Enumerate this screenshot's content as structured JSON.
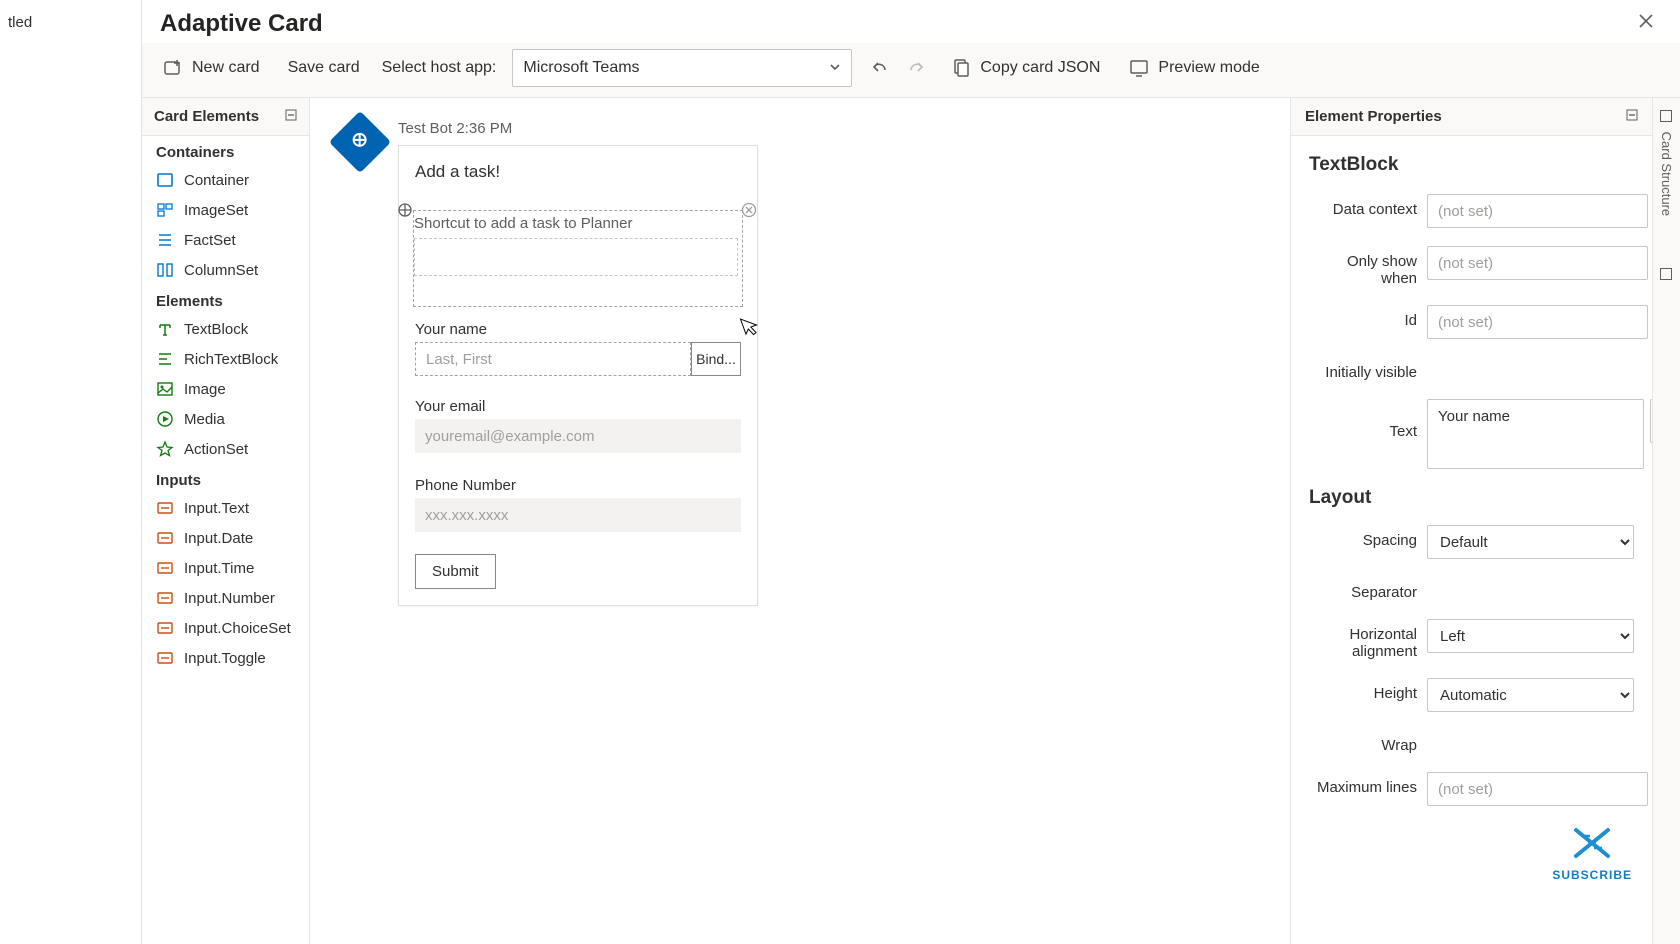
{
  "leftStub": {
    "tabText": "tled"
  },
  "title": "Adaptive Card",
  "toolbar": {
    "newCard": "New card",
    "saveCard": "Save card",
    "hostLabel": "Select host app:",
    "hostValue": "Microsoft Teams",
    "copyJson": "Copy card JSON",
    "preview": "Preview mode"
  },
  "elementsPanel": {
    "title": "Card Elements",
    "groups": [
      {
        "name": "Containers",
        "items": [
          "Container",
          "ImageSet",
          "FactSet",
          "ColumnSet"
        ]
      },
      {
        "name": "Elements",
        "items": [
          "TextBlock",
          "RichTextBlock",
          "Image",
          "Media",
          "ActionSet"
        ]
      },
      {
        "name": "Inputs",
        "items": [
          "Input.Text",
          "Input.Date",
          "Input.Time",
          "Input.Number",
          "Input.ChoiceSet",
          "Input.Toggle"
        ]
      }
    ]
  },
  "card": {
    "sender": "Test Bot 2:36 PM",
    "title": "Add a task!",
    "selectedText": "Shortcut to add a task to Planner",
    "nameLabel": "Your name",
    "namePlaceholder": "Last, First",
    "bind": "Bind...",
    "emailLabel": "Your email",
    "emailPlaceholder": "youremail@example.com",
    "phoneLabel": "Phone Number",
    "phonePlaceholder": "xxx.xxx.xxxx",
    "submit": "Submit"
  },
  "props": {
    "title": "Element Properties",
    "type": "TextBlock",
    "dataContextLabel": "Data context",
    "dataContextValue": "(not set)",
    "onlyShowLabel": "Only show when",
    "onlyShowValue": "(not set)",
    "idLabel": "Id",
    "idValue": "(not set)",
    "initiallyVisibleLabel": "Initially visible",
    "textLabel": "Text",
    "textValue": "Your name",
    "layoutHeader": "Layout",
    "spacingLabel": "Spacing",
    "spacingValue": "Default",
    "separatorLabel": "Separator",
    "halignLabel": "Horizontal alignment",
    "halignValue": "Left",
    "heightLabel": "Height",
    "heightValue": "Automatic",
    "wrapLabel": "Wrap",
    "maxLinesLabel": "Maximum lines",
    "maxLinesValue": "(not set)"
  },
  "sideTabs": {
    "structure": "Card Structure"
  },
  "subscribe": "SUBSCRIBE"
}
